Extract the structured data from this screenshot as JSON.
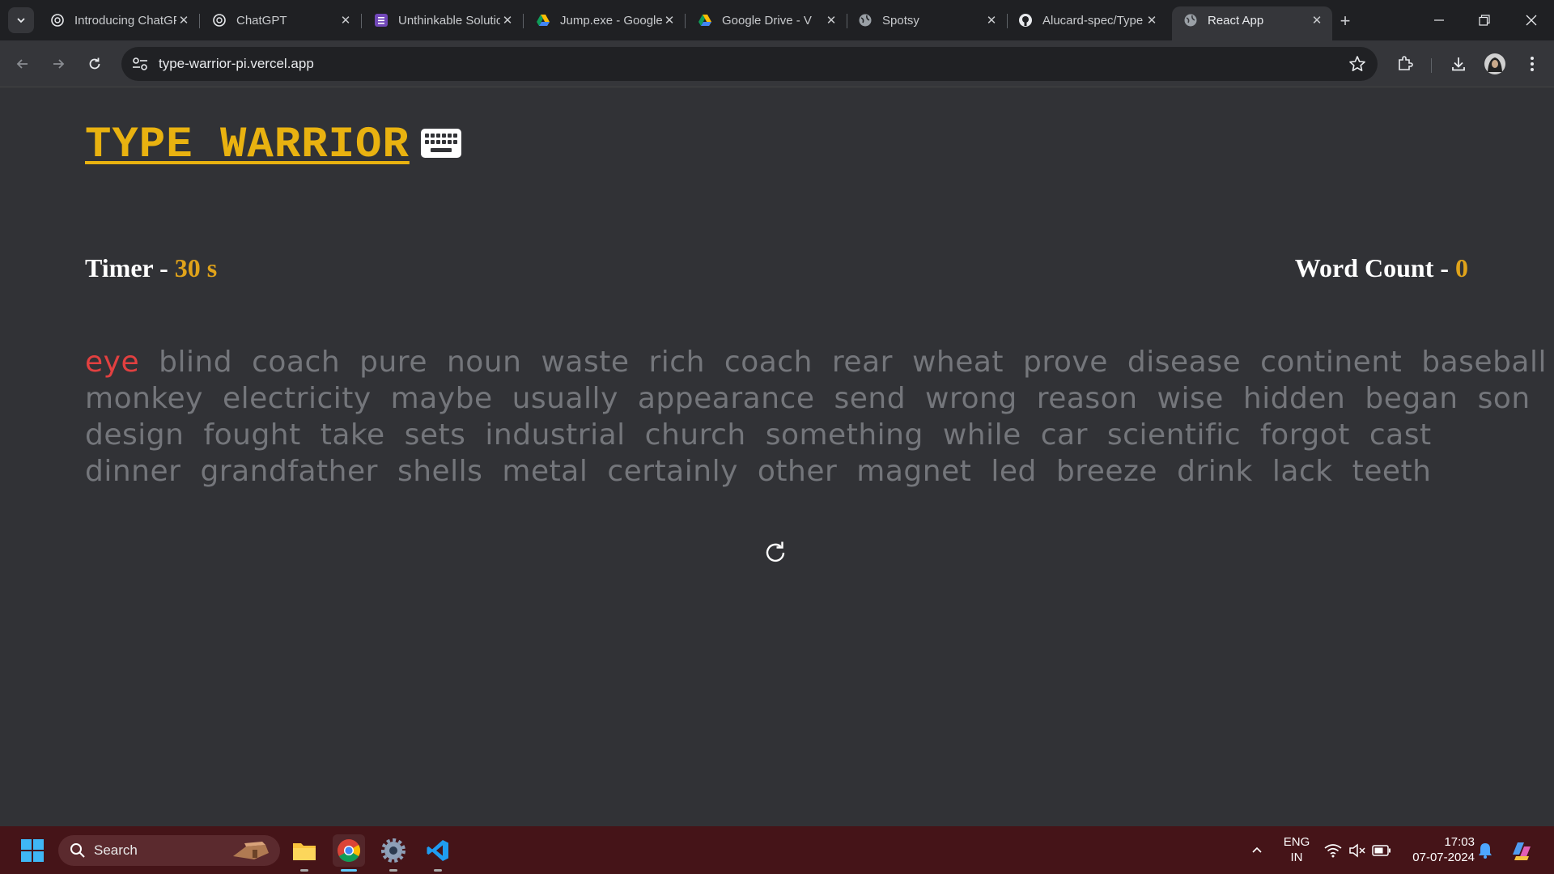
{
  "browser": {
    "tabs": [
      {
        "title": "Introducing ChatGPT",
        "icon": "openai-icon"
      },
      {
        "title": "ChatGPT",
        "icon": "openai-icon"
      },
      {
        "title": "Unthinkable Solutions",
        "icon": "form-icon"
      },
      {
        "title": "Jump.exe - Google Drive",
        "icon": "google-drive-icon"
      },
      {
        "title": "Google Drive - V",
        "icon": "google-drive-icon"
      },
      {
        "title": "Spotsy",
        "icon": "globe-icon"
      },
      {
        "title": "Alucard-spec/Type",
        "icon": "github-icon"
      },
      {
        "title": "React App",
        "icon": "globe-icon",
        "active": true
      }
    ],
    "url": "type-warrior-pi.vercel.app"
  },
  "app": {
    "title": "TYPE WARRIOR",
    "timer_label": "Timer - ",
    "timer_value": "30 s",
    "wordcount_label": "Word Count - ",
    "wordcount_value": "0",
    "current_word_index": 0,
    "word_lines": [
      [
        "eye",
        "blind",
        "coach",
        "pure",
        "noun",
        "waste",
        "rich",
        "coach",
        "rear",
        "wheat",
        "prove",
        "disease",
        "continent",
        "baseball"
      ],
      [
        "monkey",
        "electricity",
        "maybe",
        "usually",
        "appearance",
        "send",
        "wrong",
        "reason",
        "wise",
        "hidden",
        "began",
        "son"
      ],
      [
        "design",
        "fought",
        "take",
        "sets",
        "industrial",
        "church",
        "something",
        "while",
        "car",
        "scientific",
        "forgot",
        "cast"
      ],
      [
        "dinner",
        "grandfather",
        "shells",
        "metal",
        "certainly",
        "other",
        "magnet",
        "led",
        "breeze",
        "drink",
        "lack",
        "teeth"
      ]
    ],
    "colors": {
      "accent": "#e9b210",
      "stat_value": "#e0a31a",
      "current_word": "#e24040",
      "pending_word": "#74767b",
      "background": "#313236"
    }
  },
  "taskbar": {
    "search_placeholder": "Search",
    "language": "ENG",
    "region": "IN",
    "time": "17:03",
    "date": "07-07-2024"
  }
}
